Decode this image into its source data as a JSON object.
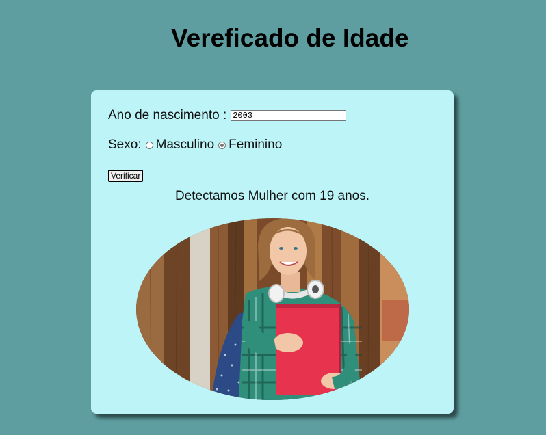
{
  "header": {
    "title": "Vereficado de Idade"
  },
  "form": {
    "year_label": "Ano de nascimento :",
    "year_value": "2003",
    "sex_label": "Sexo:",
    "options": [
      {
        "label": "Masculino",
        "checked": false
      },
      {
        "label": "Feminino",
        "checked": true
      }
    ],
    "button_label": "Verificar"
  },
  "result": {
    "text": "Detectamos Mulher com 19 anos."
  },
  "photo": {
    "subject": "smiling young woman with headphones holding red notebook",
    "colors": {
      "wood": "#8b5a33",
      "shirt": "#2f8f7a",
      "notebook": "#e8334e",
      "backpack": "#2b4a86",
      "hair": "#9c6b3e",
      "skin": "#f1c7a8"
    }
  }
}
